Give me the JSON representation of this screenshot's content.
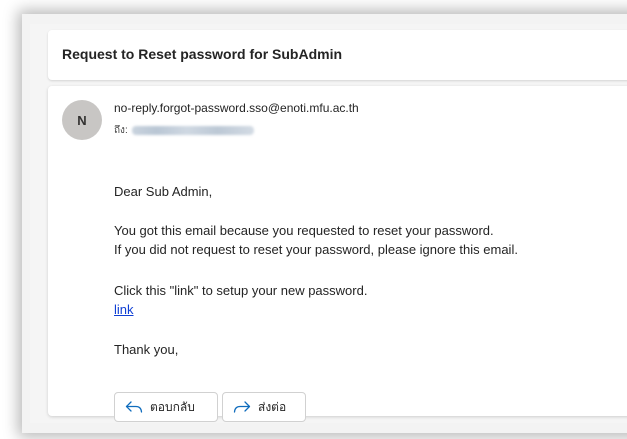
{
  "email": {
    "subject": "Request to Reset password for SubAdmin",
    "sender": {
      "initial": "N",
      "address": "no-reply.forgot-password.sso@enoti.mfu.ac.th"
    },
    "to_label": "ถึง:",
    "body": {
      "greeting": "Dear Sub Admin,",
      "line1": "You got this email because you requested to reset your password.",
      "line2": "If you did not request to reset your password, please ignore this email.",
      "line3": "Click this \"link\" to setup your new password.",
      "link_text": "link",
      "closing": "Thank you,"
    },
    "actions": {
      "reply_label": "ตอบกลับ",
      "forward_label": "ส่งต่อ"
    }
  },
  "colors": {
    "link": "#0f3fd4",
    "avatar_bg": "#c8c6c4",
    "icon_accent": "#0f6cbd"
  },
  "icons": {
    "reply": "reply-arrow-icon",
    "forward": "forward-arrow-icon"
  }
}
